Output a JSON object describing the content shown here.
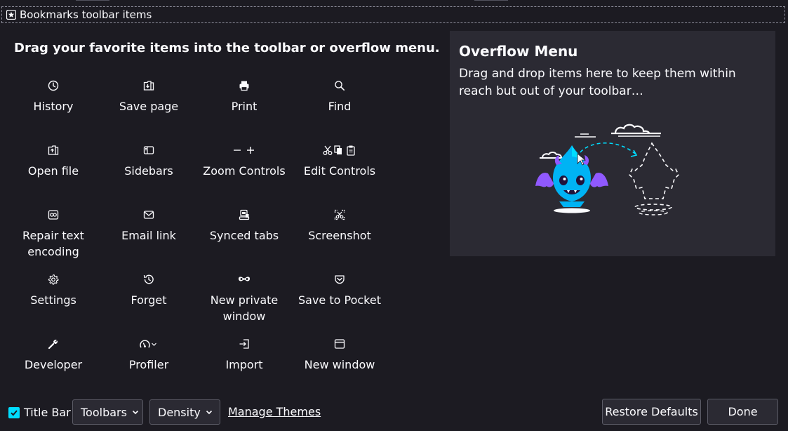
{
  "bookmarks_toolbar": {
    "label": "Bookmarks toolbar items",
    "icon": "bookmark-star-icon"
  },
  "palette": {
    "heading": "Drag your favorite items into the toolbar or overflow menu.",
    "items": [
      {
        "label": "History",
        "icon": "clock-icon"
      },
      {
        "label": "Save page",
        "icon": "save-page-icon"
      },
      {
        "label": "Print",
        "icon": "printer-icon"
      },
      {
        "label": "Find",
        "icon": "search-icon"
      },
      {
        "label": "Open file",
        "icon": "open-file-icon"
      },
      {
        "label": "Sidebars",
        "icon": "sidebar-icon"
      },
      {
        "label": "Zoom Controls",
        "icon": "zoom-minus-plus-icon"
      },
      {
        "label": "Edit Controls",
        "icon": "cut-copy-paste-icon"
      },
      {
        "label": "Repair text encoding",
        "icon": "text-encoding-icon"
      },
      {
        "label": "Email link",
        "icon": "envelope-icon"
      },
      {
        "label": "Synced tabs",
        "icon": "synced-tabs-icon"
      },
      {
        "label": "Screenshot",
        "icon": "screenshot-icon"
      },
      {
        "label": "Settings",
        "icon": "gear-icon"
      },
      {
        "label": "Forget",
        "icon": "forget-history-icon"
      },
      {
        "label": "New private window",
        "icon": "private-mask-icon"
      },
      {
        "label": "Save to Pocket",
        "icon": "pocket-icon"
      },
      {
        "label": "Developer",
        "icon": "wrench-icon"
      },
      {
        "label": "Profiler",
        "icon": "profiler-gauge-icon"
      },
      {
        "label": "Import",
        "icon": "import-icon"
      },
      {
        "label": "New window",
        "icon": "new-window-icon"
      }
    ]
  },
  "overflow": {
    "title": "Overflow Menu",
    "description": "Drag and drop items here to keep them within reach but out of your toolbar…"
  },
  "footer": {
    "title_bar_label": "Title Bar",
    "title_bar_checked": true,
    "toolbars_label": "Toolbars",
    "density_label": "Density",
    "manage_themes_label": "Manage Themes",
    "restore_defaults_label": "Restore Defaults",
    "done_label": "Done"
  },
  "colors": {
    "background": "#1c1b22",
    "panel": "#2b2a33",
    "text": "#fbfbfe",
    "accent": "#00ddff"
  }
}
